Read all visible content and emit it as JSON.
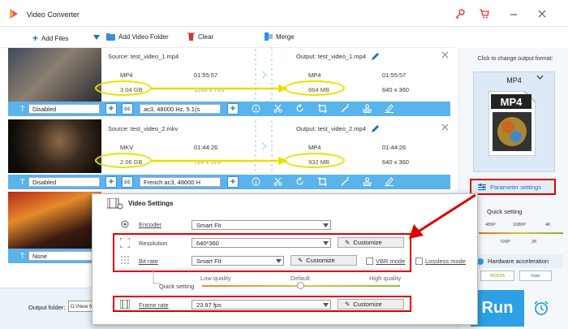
{
  "app": {
    "title": "Video Converter"
  },
  "toolbar": {
    "add_files": "Add Files",
    "add_folder": "Add Video Folder",
    "clear": "Clear",
    "merge": "Merge"
  },
  "rows": [
    {
      "source": "Source: test_video_1.mp4",
      "format": "MP4",
      "duration": "01:55:57",
      "size": "3.04 GB",
      "resolution_partial": "1280 x 720",
      "output": "Output: test_video_1.mp4",
      "out_format": "MP4",
      "out_duration": "01:55:57",
      "out_size": "664 MB",
      "out_resolution": "640 x 360",
      "subtitle": "Disabled",
      "audio": "ac3, 48000 Hz, 5.1(s"
    },
    {
      "source": "Source: test_video_2.mkv",
      "format": "MKV",
      "duration": "01:44:26",
      "size": "2.06 GB",
      "resolution_partial": "720 x 576",
      "output": "Output: test_video_2.mp4",
      "out_format": "MP4",
      "out_duration": "01:44:26",
      "out_size": "932 MB",
      "out_resolution": "640 x 360",
      "subtitle": "Disabled",
      "audio": "French ac3, 48000 H"
    },
    {
      "subtitle": "None"
    }
  ],
  "right_panel": {
    "change_label": "Click to change output format:",
    "format": "MP4",
    "param_button": "Parameter settings",
    "quick_setting": "Quick setting",
    "scale_top": [
      "480P",
      "1080P",
      "4K"
    ],
    "scale_bottom": [
      "720P",
      "2K"
    ],
    "hw_accel": "Hardware acceleration",
    "nvidia": "NVIDIA",
    "intel": "Intel",
    "run": "Run"
  },
  "footer": {
    "output_folder": "Output folder:",
    "folder_value": "D:\\New fo"
  },
  "video_settings": {
    "title": "Video Settings",
    "encoder_label": "Encoder",
    "encoder_value": "Smart Fit",
    "resolution_label": "Resolution",
    "resolution_value": "640*360",
    "bitrate_label": "Bit rate",
    "bitrate_value": "Smart Fit",
    "vbr": "VBR mode",
    "lossless": "Lossless mode",
    "customize": "Customize",
    "quick_setting": "Quick setting",
    "quality_low": "Low quality",
    "quality_default": "Default",
    "quality_high": "High quality",
    "framerate_label": "Frame rate",
    "framerate_value": "23.97 fps"
  },
  "colors": {
    "accent": "#2d9fe5",
    "bar": "#5ab3ea",
    "highlight": "#e00000",
    "ellipse": "#e8e000"
  }
}
